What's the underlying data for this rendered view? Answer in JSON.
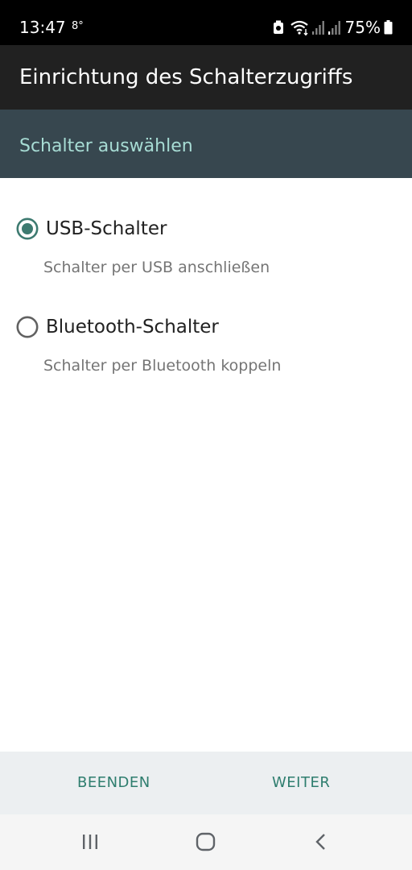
{
  "status_bar": {
    "time": "13:47",
    "temperature": "8°",
    "battery": "75%",
    "icons": [
      "recycle-icon",
      "wifi-icon",
      "signal-icon",
      "signal-icon-2",
      "battery-icon"
    ]
  },
  "header": {
    "title": "Einrichtung des Schalterzugriffs"
  },
  "section": {
    "title": "Schalter auswählen"
  },
  "options": [
    {
      "label": "USB-Schalter",
      "description": "Schalter per USB anschließen",
      "selected": true
    },
    {
      "label": "Bluetooth-Schalter",
      "description": "Schalter per Bluetooth koppeln",
      "selected": false
    }
  ],
  "footer": {
    "cancel_label": "BEENDEN",
    "next_label": "WEITER"
  },
  "navigation": {
    "icons": [
      "recent-apps-icon",
      "home-icon",
      "back-icon"
    ]
  },
  "colors": {
    "accent": "#3d7a70",
    "title_bar": "#212121",
    "subtitle_bar": "#37474f",
    "subtitle_text": "#a7dcd4",
    "footer_text": "#2e7d6e"
  }
}
